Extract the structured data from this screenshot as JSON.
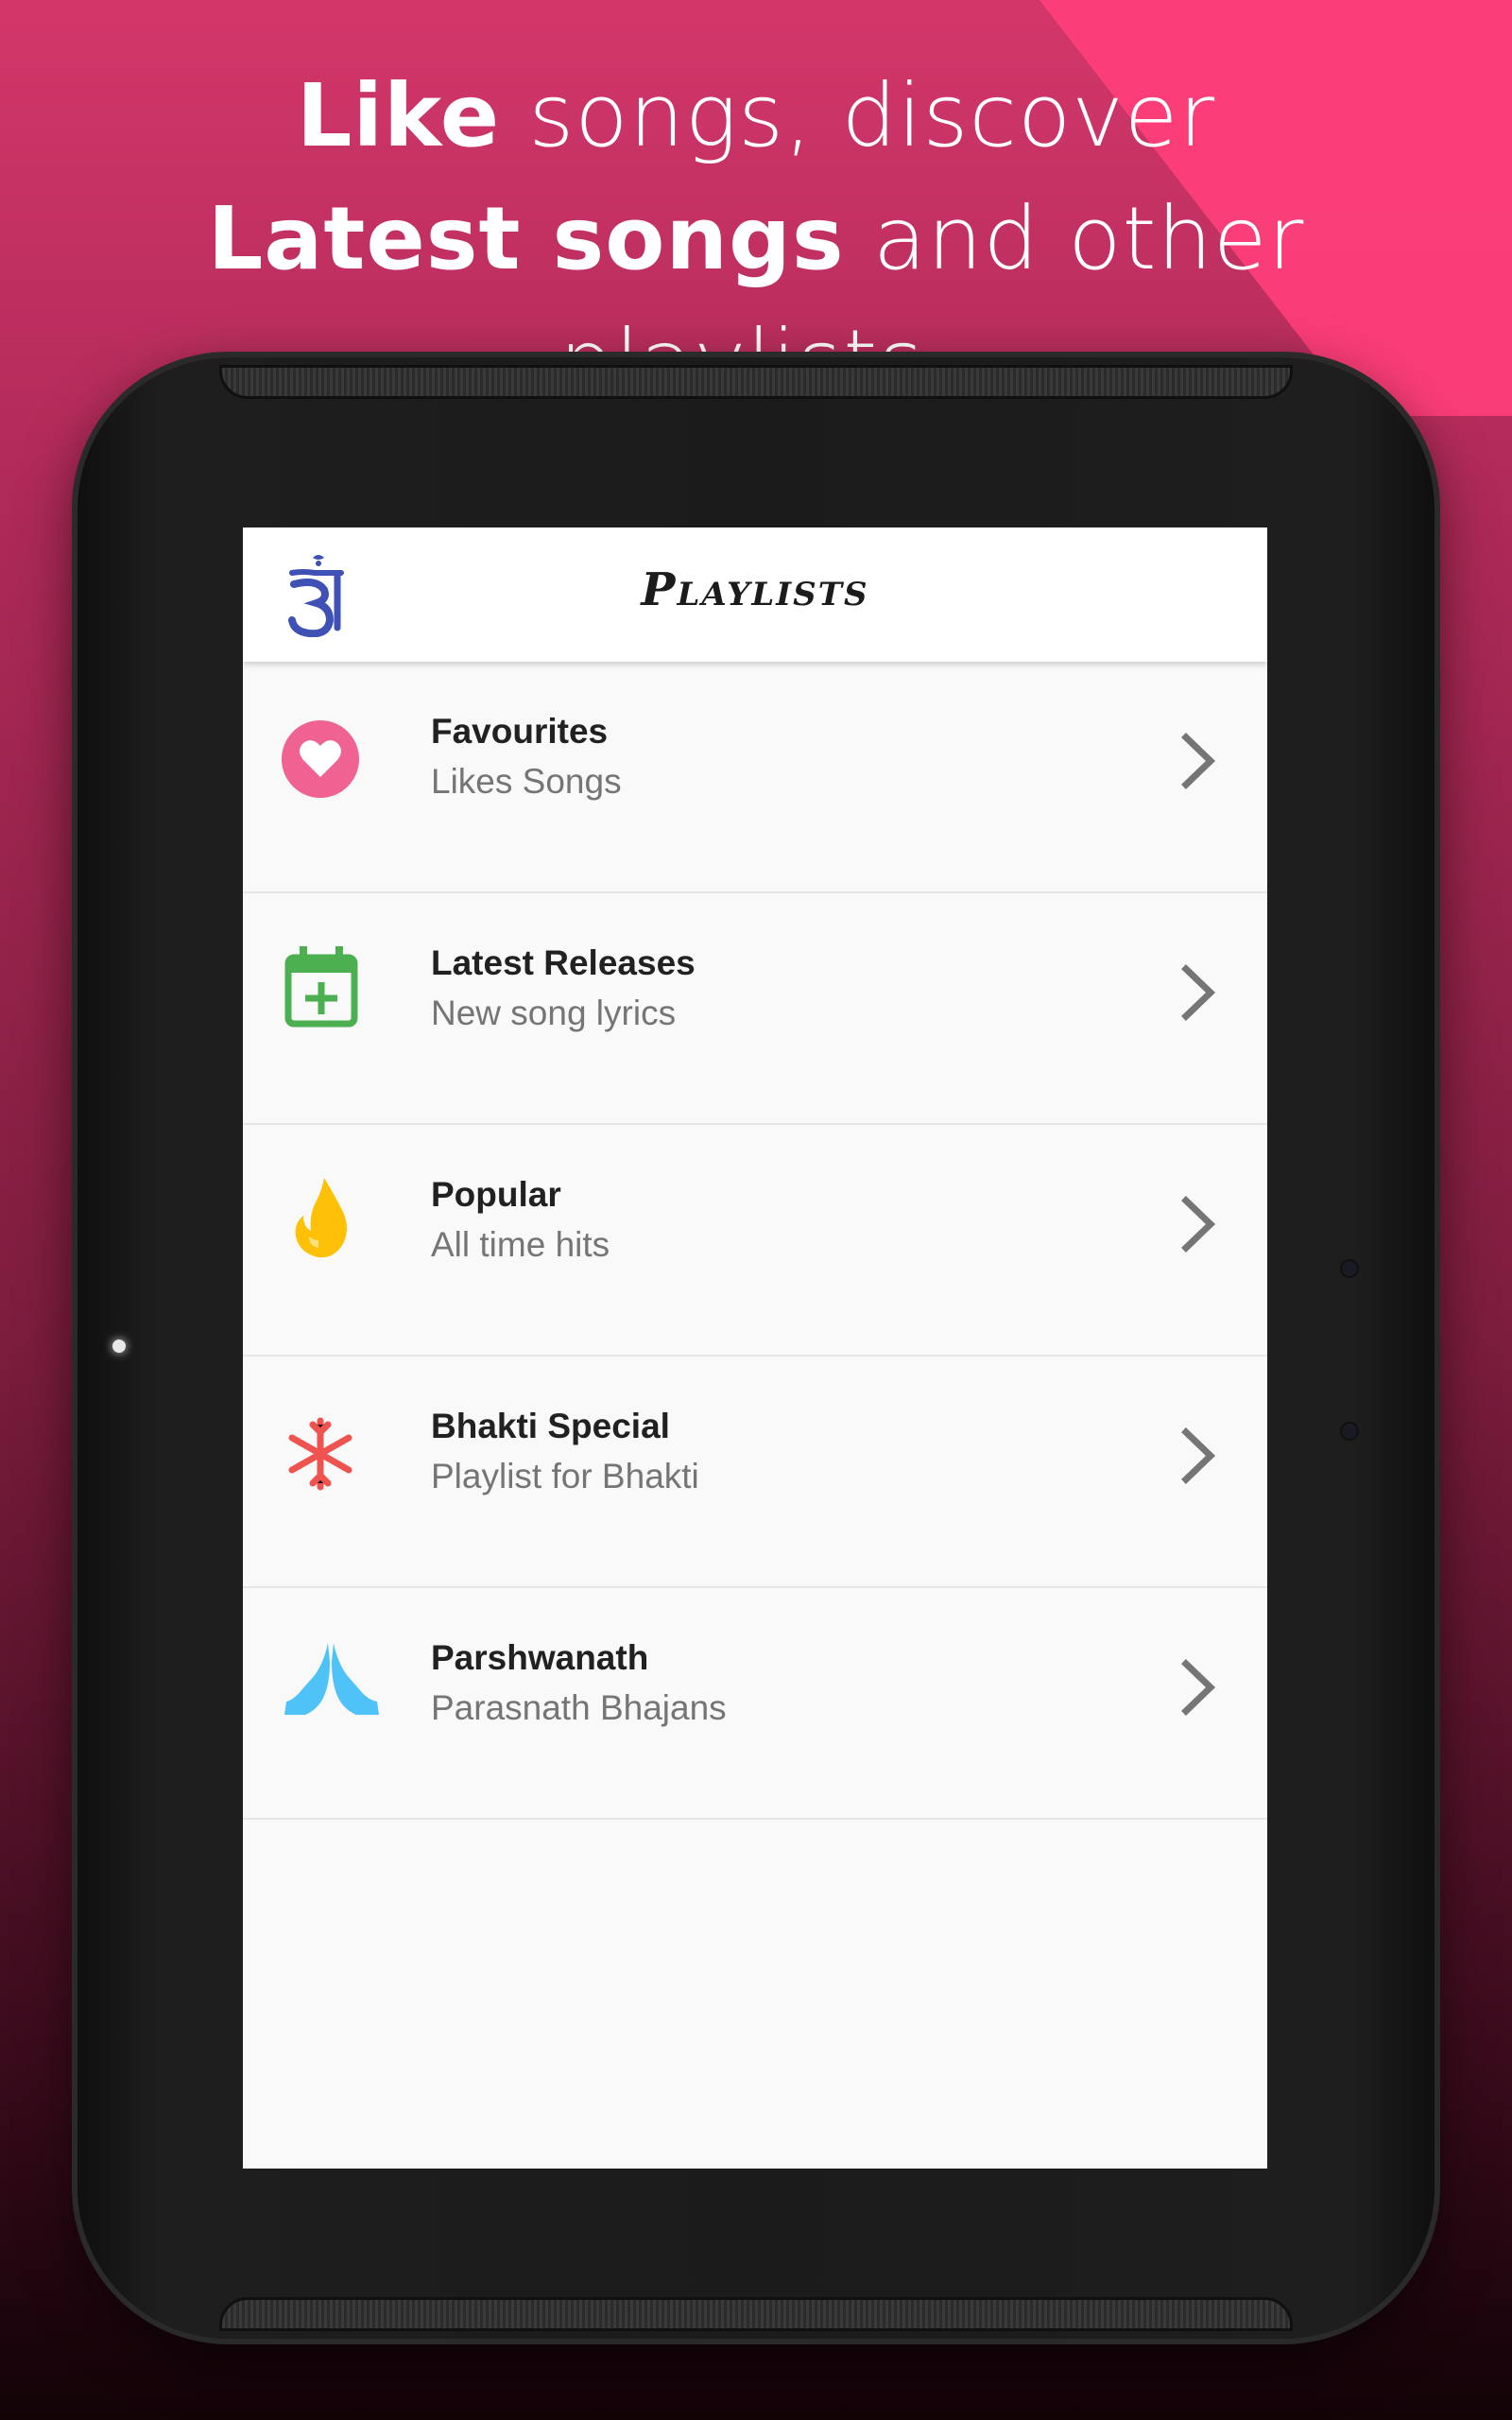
{
  "banner": {
    "line1_bold": "Like",
    "line1_rest": " songs, discover",
    "line2_bold": "Latest songs",
    "line2_rest": " and other playlists."
  },
  "appbar": {
    "title": "Playlists",
    "logo_icon": "jain-logo-icon"
  },
  "playlists": [
    {
      "title": "Favourites",
      "subtitle": "Likes Songs",
      "icon": "heart-icon",
      "color": "#f06292"
    },
    {
      "title": "Latest Releases",
      "subtitle": "New song lyrics",
      "icon": "calendar-plus-icon",
      "color": "#4caf50"
    },
    {
      "title": "Popular",
      "subtitle": "All time hits",
      "icon": "flame-icon",
      "color": "#ffc107"
    },
    {
      "title": "Bhakti Special",
      "subtitle": "Playlist for Bhakti",
      "icon": "asterisk-icon",
      "color": "#ef5350"
    },
    {
      "title": "Parshwanath",
      "subtitle": "Parasnath Bhajans",
      "icon": "praying-hands-icon",
      "color": "#4fc3f7"
    }
  ],
  "colors": {
    "chevron": "#757575",
    "background_top": "#d3376a",
    "background_bottom": "#120307"
  }
}
